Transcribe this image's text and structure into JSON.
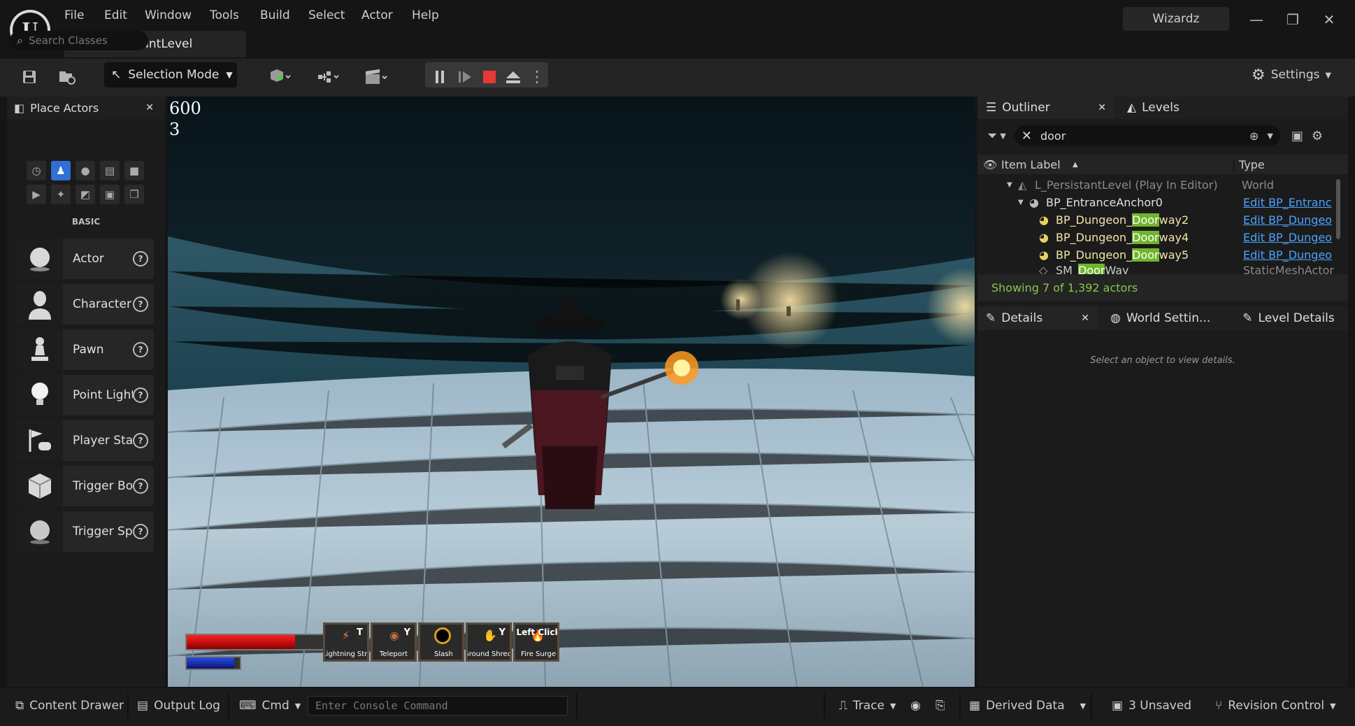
{
  "app": {
    "logo": "U",
    "project_name": "Wizardz"
  },
  "menu": [
    "File",
    "Edit",
    "Window",
    "Tools",
    "Build",
    "Select",
    "Actor",
    "Help"
  ],
  "level_tab": {
    "label": "L_PersistantLevel"
  },
  "toolbar": {
    "selection_mode": "Selection Mode",
    "settings": "Settings"
  },
  "place_actors": {
    "title": "Place Actors",
    "search_placeholder": "Search Classes",
    "category": "BASIC",
    "items": [
      {
        "label": "Actor",
        "icon": "sphere-icon"
      },
      {
        "label": "Character",
        "icon": "character-icon"
      },
      {
        "label": "Pawn",
        "icon": "pawn-icon"
      },
      {
        "label": "Point Light",
        "icon": "bulb-icon"
      },
      {
        "label": "Player Start",
        "icon": "flag-icon"
      },
      {
        "label": "Trigger Box",
        "icon": "box-icon"
      },
      {
        "label": "Trigger Sphere",
        "icon": "sphere-icon"
      }
    ]
  },
  "viewport": {
    "stat_line_1": "600",
    "stat_line_2": "3",
    "hotbar": [
      {
        "key": "T",
        "label": "Lightning Strike"
      },
      {
        "key": "Y",
        "label": "Teleport"
      },
      {
        "key": "",
        "label": "Slash"
      },
      {
        "key": "Y",
        "label": "Ground Shred"
      },
      {
        "key": "Left Click",
        "label": "Fire Surge"
      }
    ],
    "health_fraction": 0.79,
    "mana_fraction": 0.9
  },
  "outliner": {
    "tab": "Outliner",
    "levels_tab": "Levels",
    "filter_text": "door",
    "col_label": "Item Label",
    "col_type": "Type",
    "rows": [
      {
        "label": "L_PersistantLevel (Play In Editor)",
        "type": "World"
      },
      {
        "label": "BP_EntranceAnchor0",
        "type": "Edit BP_Entranc"
      },
      {
        "pre": "BP_Dungeon_",
        "hl": "Door",
        "post": "way2",
        "type": "Edit BP_Dungeo"
      },
      {
        "pre": "BP_Dungeon_",
        "hl": "Door",
        "post": "way4",
        "type": "Edit BP_Dungeo"
      },
      {
        "pre": "BP_Dungeon_",
        "hl": "Door",
        "post": "way5",
        "type": "Edit BP_Dungeo"
      },
      {
        "pre": "SM_",
        "hl": "Door",
        "post": "Way",
        "type": "StaticMeshActor"
      }
    ],
    "status": "Showing 7 of 1,392 actors"
  },
  "details": {
    "tab": "Details",
    "world_settings_tab": "World Settin...",
    "level_details_tab": "Level Details",
    "empty_message": "Select an object to view details."
  },
  "statusbar": {
    "content_drawer": "Content Drawer",
    "output_log": "Output Log",
    "cmd": "Cmd",
    "console_placeholder": "Enter Console Command",
    "trace": "Trace",
    "derived_data": "Derived Data",
    "unsaved": "3 Unsaved",
    "revision_control": "Revision Control"
  },
  "colors": {
    "highlight": "#8bc34a",
    "link": "#4aa3ff",
    "stop": "#e53935",
    "health": "#c00000",
    "mana": "#1030a0"
  }
}
